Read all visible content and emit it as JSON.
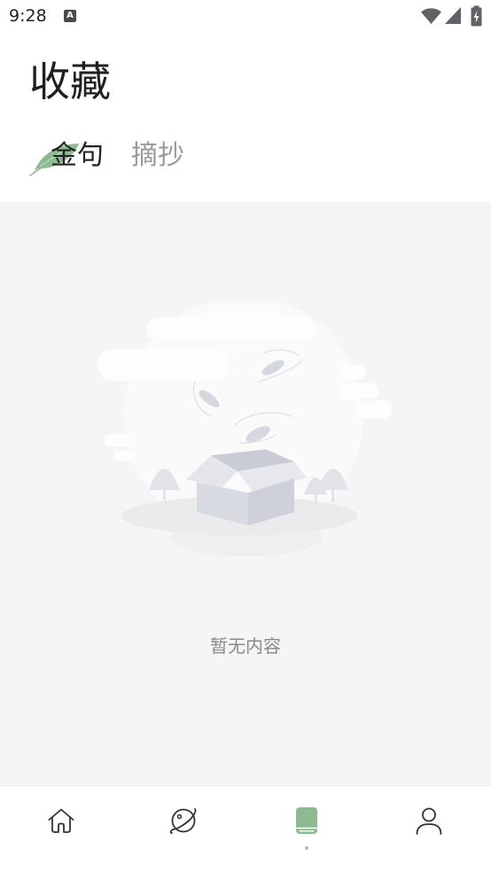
{
  "status_bar": {
    "time": "9:28",
    "notification_letter": "A",
    "icons": [
      "a-icon",
      "wifi-icon",
      "signal-icon",
      "battery-charging-icon"
    ]
  },
  "header": {
    "title": "收藏"
  },
  "tabs": [
    {
      "label": "金句",
      "active": true,
      "decoration": "leaf-icon"
    },
    {
      "label": "摘抄",
      "active": false
    }
  ],
  "empty_state": {
    "illustration": "empty-box-illustration",
    "message": "暂无内容"
  },
  "bottom_nav": {
    "items": [
      {
        "icon": "home-icon",
        "active": false
      },
      {
        "icon": "planet-icon",
        "active": false
      },
      {
        "icon": "book-icon",
        "active": true
      },
      {
        "icon": "user-icon",
        "active": false
      }
    ]
  },
  "colors": {
    "accent": "#8dbb8f",
    "content_background": "#f5f5f5",
    "text_primary": "#222222",
    "text_inactive": "#9a9a9a",
    "empty_text": "#8a8a8a"
  }
}
